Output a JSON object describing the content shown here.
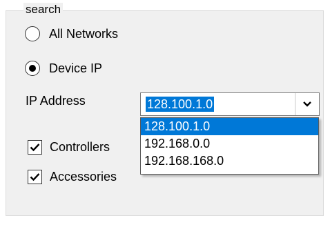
{
  "group": {
    "title": "search"
  },
  "scope": {
    "options": [
      {
        "label": "All Networks",
        "selected": false
      },
      {
        "label": "Device IP",
        "selected": true
      }
    ]
  },
  "ip": {
    "label": "IP Address",
    "value": "128.100.1.0",
    "arrow_icon": "chevron-down-icon",
    "options": [
      "128.100.1.0",
      "192.168.0.0",
      "192.168.168.0"
    ],
    "selected_option": "128.100.1.0"
  },
  "filters": [
    {
      "label": "Controllers",
      "checked": true
    },
    {
      "label": "Accessories",
      "checked": true
    }
  ],
  "colors": {
    "highlight": "#0078d7",
    "panel": "#f0f0f0"
  }
}
